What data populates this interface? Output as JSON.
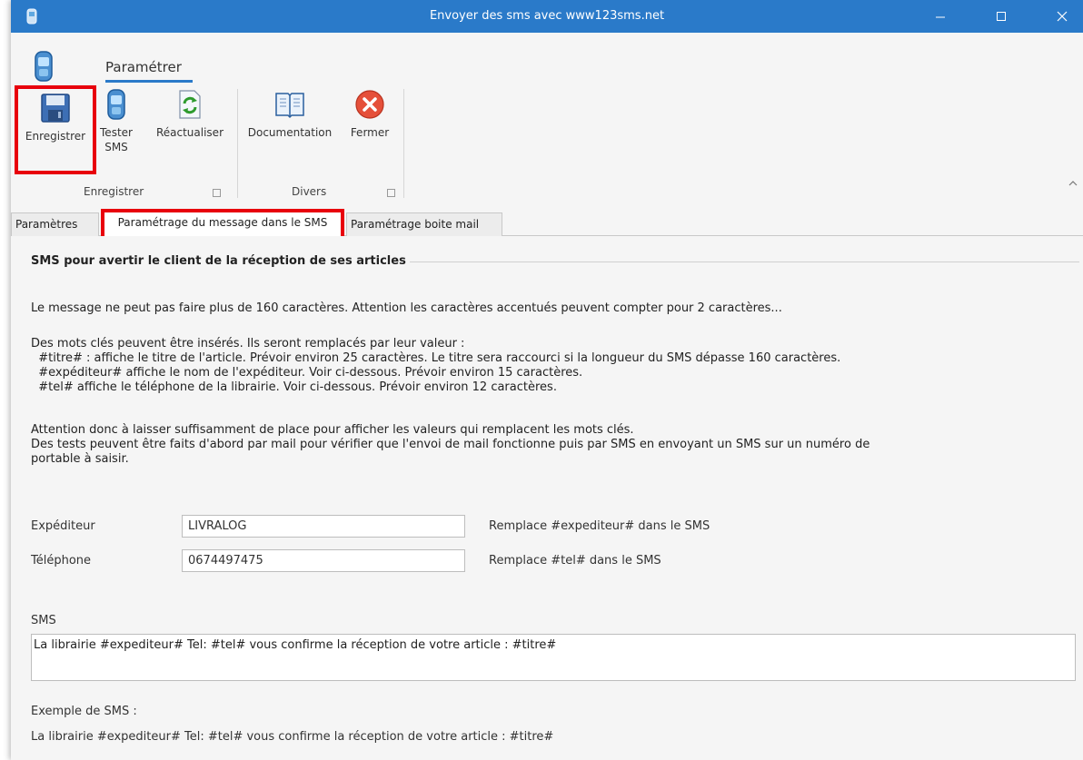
{
  "window": {
    "title": "Envoyer des sms avec www123sms.net"
  },
  "ribbon": {
    "tab": "Paramétrer",
    "buttons": {
      "save": "Enregistrer",
      "test_line1": "Tester",
      "test_line2": "SMS",
      "refresh": "Réactualiser",
      "doc": "Documentation",
      "close": "Fermer"
    },
    "groups": {
      "save": "Enregistrer",
      "misc": "Divers"
    }
  },
  "tabs": {
    "params": "Paramètres",
    "message": "Paramétrage du message dans le SMS",
    "mail": "Paramétrage boite mail"
  },
  "content": {
    "section_title": "SMS pour avertir le client de la réception de ses articles",
    "intro": "Le message ne peut pas faire plus de 160 caractères. Attention les caractères accentués peuvent compter pour 2 caractères...",
    "keywords": [
      "Des mots clés peuvent être insérés. Ils seront remplacés par leur valeur :",
      "  #titre# : affiche le titre de l'article. Prévoir environ 25 caractères. Le titre sera raccourci si la longueur du SMS dépasse 160 caractères.",
      "  #expéditeur# affiche le nom de l'expéditeur. Voir ci-dessous. Prévoir environ 15 caractères.",
      "  #tel# affiche le téléphone de la librairie. Voir ci-dessous. Prévoir environ 12 caractères."
    ],
    "warning": [
      "Attention donc à laisser suffisamment de place pour afficher les valeurs qui remplacent les mots clés.",
      "Des tests peuvent être faits d'abord par mail pour vérifier que l'envoi de mail fonctionne puis par SMS en envoyant un SMS sur un numéro de",
      "portable à saisir."
    ],
    "sender": {
      "label": "Expéditeur",
      "value": "LIVRALOG",
      "note": "Remplace #expediteur# dans le SMS"
    },
    "phone": {
      "label": "Téléphone",
      "value": "0674497475",
      "note": "Remplace #tel# dans le SMS"
    },
    "sms": {
      "label": "SMS",
      "value": "La librairie #expediteur#  Tel: #tel# vous confirme la réception de votre article : #titre#"
    },
    "example": {
      "label": "Exemple de SMS :",
      "value": "La librairie #expediteur#  Tel: #tel# vous confirme la réception de votre article : #titre#"
    }
  },
  "colors": {
    "titlebar": "#2a7ac9",
    "highlight": "#e8000c"
  }
}
